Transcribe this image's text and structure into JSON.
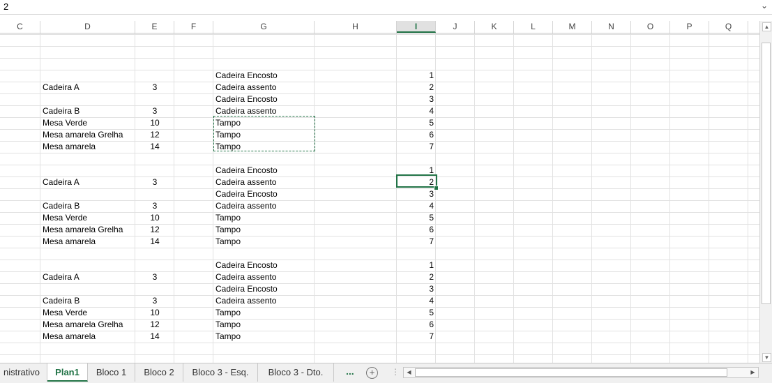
{
  "formula_bar": {
    "value": "2",
    "expand_icon": "chevron-down-icon"
  },
  "columns": [
    "C",
    "D",
    "E",
    "F",
    "G",
    "H",
    "I",
    "J",
    "K",
    "L",
    "M",
    "N",
    "O",
    "P",
    "Q"
  ],
  "active_column": "I",
  "blocks": [
    {
      "items": [
        {
          "name": "Cadeira A",
          "qty": "3"
        },
        {
          "name": "Cadeira B",
          "qty": "3"
        },
        {
          "name": "Mesa Verde",
          "qty": "10"
        },
        {
          "name": "Mesa amarela Grelha",
          "qty": "12"
        },
        {
          "name": "Mesa amarela",
          "qty": "14"
        }
      ],
      "parts": [
        {
          "part": "Cadeira Encosto",
          "n": "1"
        },
        {
          "part": "Cadeira assento",
          "n": "2"
        },
        {
          "part": "Cadeira Encosto",
          "n": "3"
        },
        {
          "part": "Cadeira assento",
          "n": "4"
        },
        {
          "part": "Tampo",
          "n": "5"
        },
        {
          "part": "Tampo",
          "n": "6"
        },
        {
          "part": "Tampo",
          "n": "7"
        }
      ]
    },
    {
      "items": [
        {
          "name": "Cadeira A",
          "qty": "3"
        },
        {
          "name": "Cadeira B",
          "qty": "3"
        },
        {
          "name": "Mesa Verde",
          "qty": "10"
        },
        {
          "name": "Mesa amarela Grelha",
          "qty": "12"
        },
        {
          "name": "Mesa amarela",
          "qty": "14"
        }
      ],
      "parts": [
        {
          "part": "Cadeira Encosto",
          "n": "1"
        },
        {
          "part": "Cadeira assento",
          "n": "2"
        },
        {
          "part": "Cadeira Encosto",
          "n": "3"
        },
        {
          "part": "Cadeira assento",
          "n": "4"
        },
        {
          "part": "Tampo",
          "n": "5"
        },
        {
          "part": "Tampo",
          "n": "6"
        },
        {
          "part": "Tampo",
          "n": "7"
        }
      ]
    },
    {
      "items": [
        {
          "name": "Cadeira A",
          "qty": "3"
        },
        {
          "name": "Cadeira B",
          "qty": "3"
        },
        {
          "name": "Mesa Verde",
          "qty": "10"
        },
        {
          "name": "Mesa amarela Grelha",
          "qty": "12"
        },
        {
          "name": "Mesa amarela",
          "qty": "14"
        }
      ],
      "parts": [
        {
          "part": "Cadeira Encosto",
          "n": "1"
        },
        {
          "part": "Cadeira assento",
          "n": "2"
        },
        {
          "part": "Cadeira Encosto",
          "n": "3"
        },
        {
          "part": "Cadeira assento",
          "n": "4"
        },
        {
          "part": "Tampo",
          "n": "5"
        },
        {
          "part": "Tampo",
          "n": "6"
        },
        {
          "part": "Tampo",
          "n": "7"
        }
      ]
    }
  ],
  "sheet_tabs": {
    "tabs": [
      "nistrativo",
      "Plan1",
      "Bloco 1",
      "Bloco 2",
      "Bloco 3 - Esq.",
      "Bloco 3 - Dto."
    ],
    "active": "Plan1",
    "more_label": "...",
    "add_label": "+",
    "separator": "⋮"
  },
  "colors": {
    "accent": "#217346",
    "gridline": "#e1e1e1",
    "header_bg": "#e1e1e1"
  }
}
